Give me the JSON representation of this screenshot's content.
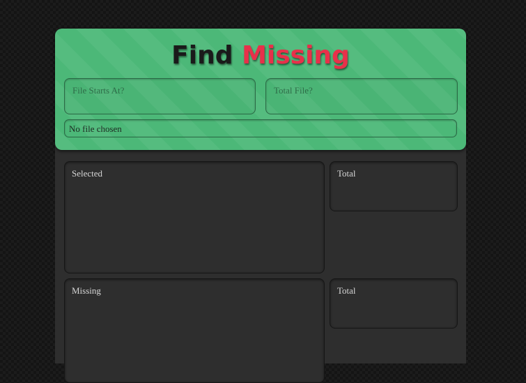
{
  "title": {
    "word1": "Find",
    "word2": "Missing"
  },
  "inputs": {
    "file_starts_at_placeholder": "File Starts At?",
    "total_file_placeholder": "Total File?"
  },
  "file_input": {
    "status": "No file chosen"
  },
  "panels": {
    "selected_label": "Selected",
    "selected_total_label": "Total",
    "missing_label": "Missing",
    "missing_total_label": "Total"
  },
  "colors": {
    "header_green": "#4cb878",
    "title_dark": "#1a1a1a",
    "title_red": "#e8304a",
    "panel_bg": "#2e2e2e"
  }
}
